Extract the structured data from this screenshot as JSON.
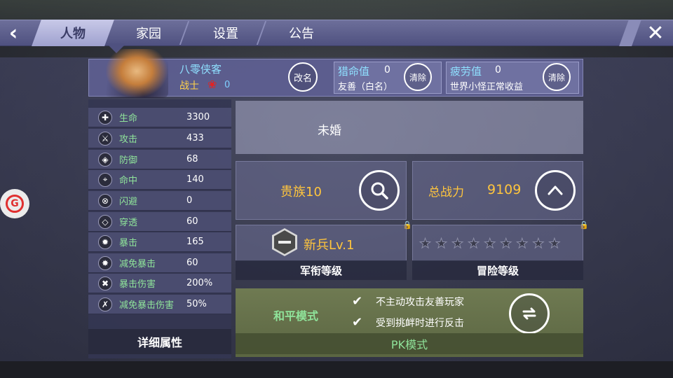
{
  "nav": {
    "tabs": [
      {
        "label": "人物",
        "active": true
      },
      {
        "label": "家园",
        "active": false
      },
      {
        "label": "设置",
        "active": false
      },
      {
        "label": "公告",
        "active": false
      }
    ],
    "back_icon": "chevron-left-icon",
    "close_icon": "close-icon"
  },
  "character": {
    "name": "八零侠客",
    "class": "战士",
    "rose_count": "0",
    "rename_label": "改名"
  },
  "hunt": {
    "title": "猎命值",
    "value": "0",
    "desc": "友善（白名）",
    "clear_label": "清除"
  },
  "fatigue": {
    "title": "疲劳值",
    "value": "0",
    "desc": "世界小怪正常收益",
    "clear_label": "清除"
  },
  "stats": [
    {
      "icon": "plus-icon",
      "label": "生命",
      "value": "3300"
    },
    {
      "icon": "sword-icon",
      "label": "攻击",
      "value": "433"
    },
    {
      "icon": "shield-icon",
      "label": "防御",
      "value": "68"
    },
    {
      "icon": "crosshair-icon",
      "label": "命中",
      "value": "140"
    },
    {
      "icon": "dodge-icon",
      "label": "闪避",
      "value": "0"
    },
    {
      "icon": "pierce-icon",
      "label": "穿透",
      "value": "60"
    },
    {
      "icon": "burst-icon",
      "label": "暴击",
      "value": "165"
    },
    {
      "icon": "burst-resist-icon",
      "label": "减免暴击",
      "value": "60"
    },
    {
      "icon": "crossed-swords-icon",
      "label": "暴击伤害",
      "value": "200%"
    },
    {
      "icon": "crossed-swords-resist-icon",
      "label": "减免暴击伤害",
      "value": "50%"
    }
  ],
  "detail_label": "详细属性",
  "marriage": "未婚",
  "noble": "贵族10",
  "power": {
    "label": "总战力",
    "value": "9109"
  },
  "rank": {
    "text": "新兵Lv.1",
    "caption": "军衔等级"
  },
  "adventure": {
    "caption": "冒险等级",
    "stars_filled": 0,
    "stars_total": 9
  },
  "pk": {
    "mode": "和平模式",
    "rules": [
      "不主动攻击友善玩家",
      "受到挑衅时进行反击"
    ],
    "caption": "PK模式"
  },
  "colors": {
    "accent_gold": "#ffc53d",
    "accent_green": "#8fe39a",
    "accent_cyan": "#8fe0ff",
    "tab_bar": "#5f6190"
  }
}
